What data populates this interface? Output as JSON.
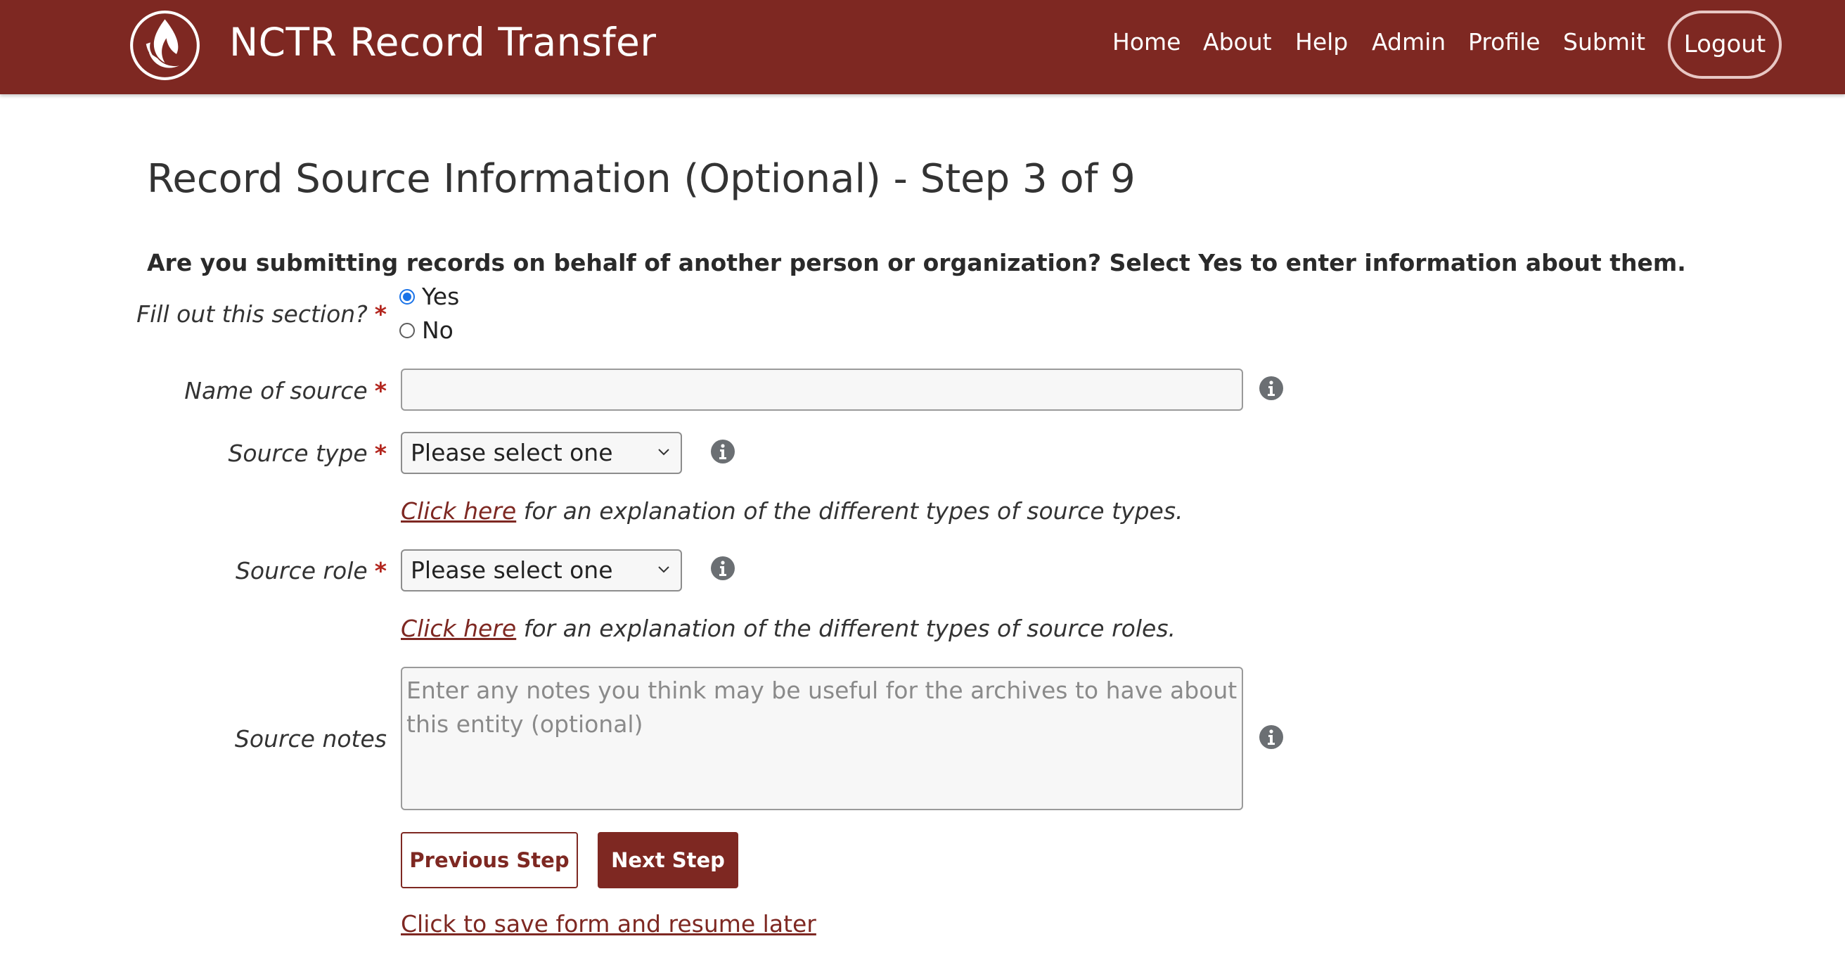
{
  "header": {
    "brand": "NCTR Record Transfer",
    "nav": [
      {
        "label": "Home"
      },
      {
        "label": "About"
      },
      {
        "label": "Help"
      },
      {
        "label": "Admin"
      },
      {
        "label": "Profile"
      },
      {
        "label": "Submit"
      }
    ],
    "logout_label": "Logout",
    "bg_color": "#7e2822"
  },
  "page": {
    "title": "Record Source Information (Optional) - Step 3 of 9",
    "question": "Are you submitting records on behalf of another person or organization? Select Yes to enter information about them."
  },
  "form": {
    "fill_section": {
      "label": "Fill out this section?",
      "required_mark": "*",
      "options": [
        {
          "label": "Yes",
          "checked": true
        },
        {
          "label": "No",
          "checked": false
        }
      ]
    },
    "name_of_source": {
      "label": "Name of source",
      "required_mark": "*",
      "value": ""
    },
    "source_type": {
      "label": "Source type",
      "required_mark": "*",
      "selected": "Please select one",
      "help_link": "Click here",
      "help_text": " for an explanation of the different types of source types."
    },
    "source_role": {
      "label": "Source role",
      "required_mark": "*",
      "selected": "Please select one",
      "help_link": "Click here",
      "help_text": " for an explanation of the different types of source roles."
    },
    "source_notes": {
      "label": "Source notes",
      "placeholder": "Enter any notes you think may be useful for the archives to have about this entity (optional)"
    }
  },
  "actions": {
    "previous_label": "Previous Step",
    "next_label": "Next Step",
    "save_link": "Click to save form and resume later"
  }
}
